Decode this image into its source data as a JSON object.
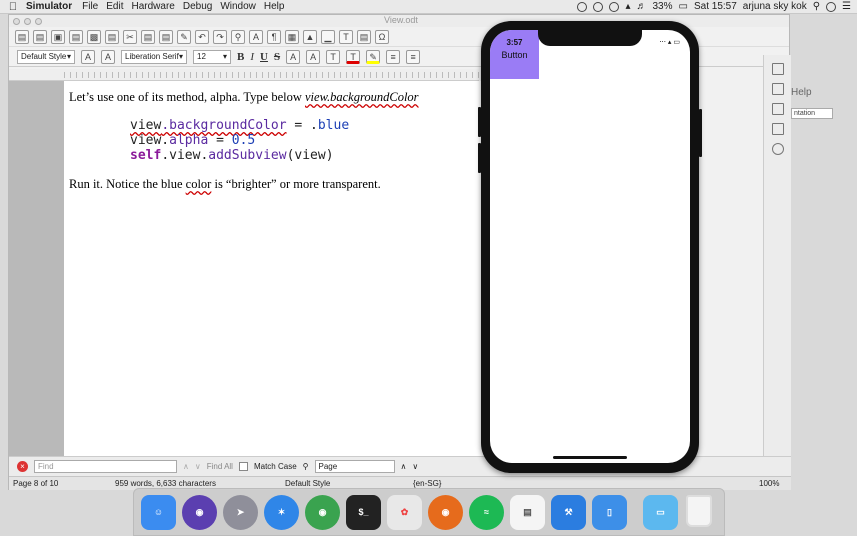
{
  "menubar": {
    "app_name": "Simulator",
    "items": [
      "File",
      "Edit",
      "Hardware",
      "Debug",
      "Window",
      "Help"
    ],
    "battery": "33%",
    "clock": "Sat 15:57",
    "user": "arjuna sky kok"
  },
  "window": {
    "title": "View.odt"
  },
  "format_toolbar": {
    "paragraph_style": "Default Style",
    "font_name": "Liberation Serif",
    "font_size": "12",
    "bold": "B",
    "italic": "I",
    "underline": "U",
    "strike": "S"
  },
  "document": {
    "line1_prefix": "Let’s use one of its method, alpha. Type below ",
    "line1_italic": "view.backgroundColor",
    "code_line1_a": "view",
    "code_line1_b": ".backgroundColor",
    "code_line1_c": " = .",
    "code_line1_d": "blue",
    "code_line2_a": "view.",
    "code_line2_b": "alpha",
    "code_line2_c": " = ",
    "code_line2_d": "0.5",
    "code_line3_a": "self",
    "code_line3_b": ".view.",
    "code_line3_c": "addSubview",
    "code_line3_d": "(view)",
    "line2_prefix": "Run it. Notice the blue ",
    "line2_underlined": "color",
    "line2_suffix": " is “brighter” or more transparent."
  },
  "sidebar": {
    "help_label": "Help",
    "help_box": "ntation"
  },
  "findbar": {
    "find_placeholder": "Find",
    "find_all": "Find All",
    "match_case": "Match Case",
    "search_scope": "Page"
  },
  "statusbar": {
    "page": "Page 8 of 10",
    "words": "959 words, 6,633 characters",
    "style": "Default Style",
    "language": "{en-SG}",
    "zoom": "100%"
  },
  "simulator": {
    "time": "3:57",
    "button_label": "Button",
    "button_color": "#9a7cf5"
  },
  "dock": {
    "apps": [
      {
        "name": "finder-icon",
        "color": "#3b8cf0"
      },
      {
        "name": "siri-icon",
        "color": "#5b3fb0"
      },
      {
        "name": "launchpad-icon",
        "color": "#8f8f9a"
      },
      {
        "name": "safari-icon",
        "color": "#2f86e8"
      },
      {
        "name": "chrome-icon",
        "color": "#3aa34f"
      },
      {
        "name": "terminal-icon",
        "color": "#222222"
      },
      {
        "name": "photos-icon",
        "color": "#e8e8e8"
      },
      {
        "name": "firefox-icon",
        "color": "#e66b1c"
      },
      {
        "name": "spotify-icon",
        "color": "#1db954"
      },
      {
        "name": "libreoffice-icon",
        "color": "#f5f5f5"
      },
      {
        "name": "xcode-icon",
        "color": "#2b7de0"
      },
      {
        "name": "simulator-icon",
        "color": "#3d8fe8"
      },
      {
        "name": "folder-icon",
        "color": "#5cb8ef"
      }
    ]
  }
}
